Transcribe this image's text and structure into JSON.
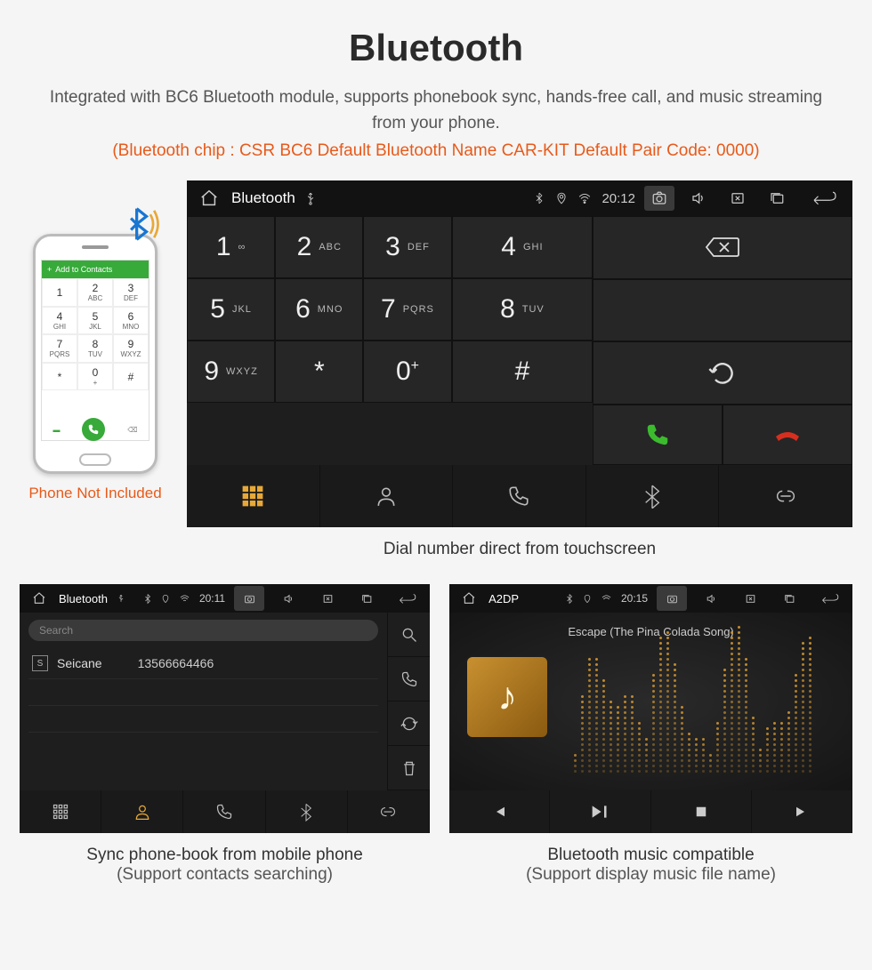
{
  "heading": "Bluetooth",
  "subtitle": "Integrated with BC6 Bluetooth module, supports phonebook sync, hands-free call, and music streaming from your phone.",
  "note": "(Bluetooth chip : CSR BC6    Default Bluetooth Name CAR-KIT    Default Pair Code: 0000)",
  "phone": {
    "topbar": "Add to Contacts",
    "not_included": "Phone Not Included",
    "keys": [
      {
        "n": "1",
        "l": ""
      },
      {
        "n": "2",
        "l": "ABC"
      },
      {
        "n": "3",
        "l": "DEF"
      },
      {
        "n": "4",
        "l": "GHI"
      },
      {
        "n": "5",
        "l": "JKL"
      },
      {
        "n": "6",
        "l": "MNO"
      },
      {
        "n": "7",
        "l": "PQRS"
      },
      {
        "n": "8",
        "l": "TUV"
      },
      {
        "n": "9",
        "l": "WXYZ"
      },
      {
        "n": "*",
        "l": ""
      },
      {
        "n": "0",
        "l": "+"
      },
      {
        "n": "#",
        "l": ""
      }
    ]
  },
  "main_hu": {
    "title": "Bluetooth",
    "time": "20:12",
    "keys": [
      {
        "n": "1",
        "l": "∞"
      },
      {
        "n": "2",
        "l": "ABC"
      },
      {
        "n": "3",
        "l": "DEF"
      },
      {
        "n": "4",
        "l": "GHI"
      },
      {
        "n": "5",
        "l": "JKL"
      },
      {
        "n": "6",
        "l": "MNO"
      },
      {
        "n": "7",
        "l": "PQRS"
      },
      {
        "n": "8",
        "l": "TUV"
      },
      {
        "n": "9",
        "l": "WXYZ"
      },
      {
        "n": "*",
        "l": ""
      },
      {
        "n": "0",
        "l": "+"
      },
      {
        "n": "#",
        "l": ""
      }
    ],
    "caption": "Dial number direct from touchscreen"
  },
  "contacts_hu": {
    "title": "Bluetooth",
    "time": "20:11",
    "search_placeholder": "Search",
    "contact_badge": "S",
    "contact_name": "Seicane",
    "contact_number": "13566664466",
    "caption_line1": "Sync phone-book from mobile phone",
    "caption_line2": "(Support contacts searching)"
  },
  "music_hu": {
    "title": "A2DP",
    "time": "20:15",
    "track": "Escape (The Pina Colada Song)",
    "caption_line1": "Bluetooth music compatible",
    "caption_line2": "(Support display music file name)"
  }
}
